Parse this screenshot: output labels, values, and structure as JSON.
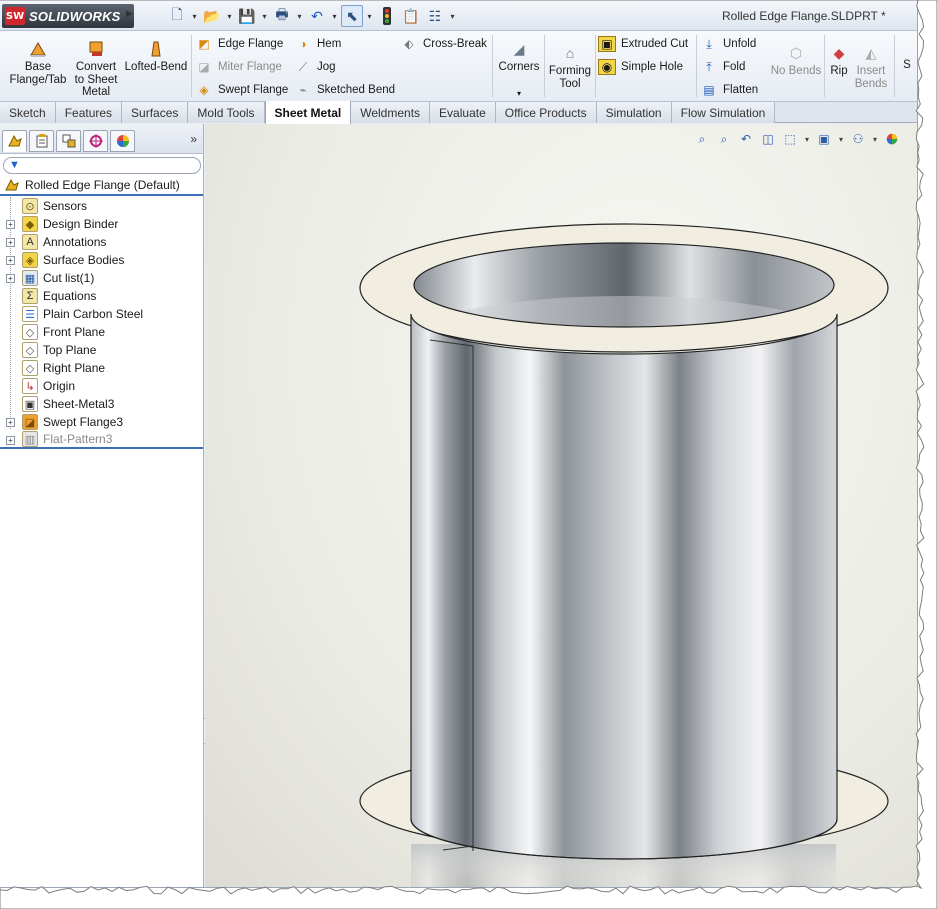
{
  "app": {
    "brand_short": "SW",
    "brand": "SOLIDWORKS",
    "document_title": "Rolled Edge Flange.SLDPRT *"
  },
  "quick_access": [
    {
      "name": "new-icon"
    },
    {
      "name": "open-icon"
    },
    {
      "name": "save-icon"
    },
    {
      "name": "print-icon"
    },
    {
      "name": "undo-icon"
    },
    {
      "name": "select-icon"
    },
    {
      "name": "rebuild-icon"
    },
    {
      "name": "file-properties-icon"
    },
    {
      "name": "options-icon"
    }
  ],
  "ribbon": {
    "base_flange": "Base\nFlange/Tab",
    "convert": "Convert\nto Sheet\nMetal",
    "lofted_bend": "Lofted-Bend",
    "edge_flange": "Edge Flange",
    "miter_flange": "Miter Flange",
    "swept_flange": "Swept Flange",
    "hem": "Hem",
    "jog": "Jog",
    "sketched_bend": "Sketched Bend",
    "cross_break": "Cross-Break",
    "corners": "Corners",
    "forming_tool": "Forming\nTool",
    "extruded_cut": "Extruded Cut",
    "simple_hole": "Simple Hole",
    "unfold": "Unfold",
    "fold": "Fold",
    "flatten": "Flatten",
    "no_bends": "No Bends",
    "rip": "Rip",
    "insert_bends": "Insert\nBends",
    "cut_off_label": "S"
  },
  "tabs": [
    "Sketch",
    "Features",
    "Surfaces",
    "Mold Tools",
    "Sheet Metal",
    "Weldments",
    "Evaluate",
    "Office Products",
    "Simulation",
    "Flow Simulation"
  ],
  "active_tab": "Sheet Metal",
  "feature_tree": {
    "root": "Rolled Edge Flange  (Default)",
    "items": [
      {
        "label": "Sensors",
        "icon": "sensor-icon",
        "expand": false
      },
      {
        "label": "Design Binder",
        "icon": "design-binder-icon",
        "expand": true
      },
      {
        "label": "Annotations",
        "icon": "annotations-icon",
        "expand": true
      },
      {
        "label": "Surface Bodies",
        "icon": "surface-bodies-icon",
        "expand": true
      },
      {
        "label": "Cut list(1)",
        "icon": "cut-list-icon",
        "expand": true
      },
      {
        "label": "Equations",
        "icon": "equations-icon",
        "expand": false
      },
      {
        "label": "Plain Carbon Steel",
        "icon": "material-icon",
        "expand": false
      },
      {
        "label": "Front Plane",
        "icon": "plane-icon",
        "expand": false
      },
      {
        "label": "Top Plane",
        "icon": "plane-icon",
        "expand": false
      },
      {
        "label": "Right Plane",
        "icon": "plane-icon",
        "expand": false
      },
      {
        "label": "Origin",
        "icon": "origin-icon",
        "expand": false
      },
      {
        "label": "Sheet-Metal3",
        "icon": "sheet-metal-icon",
        "expand": false
      },
      {
        "label": "Swept Flange3",
        "icon": "swept-flange-icon",
        "expand": true
      },
      {
        "label": "Flat-Pattern3",
        "icon": "flat-pattern-icon",
        "expand": true,
        "suppressed": true
      }
    ]
  },
  "colors": {
    "accent": "#3f6fb5",
    "flange": "#f1ede0",
    "steel_dark": "#8e9398",
    "steel_light": "#f4f5f6"
  }
}
